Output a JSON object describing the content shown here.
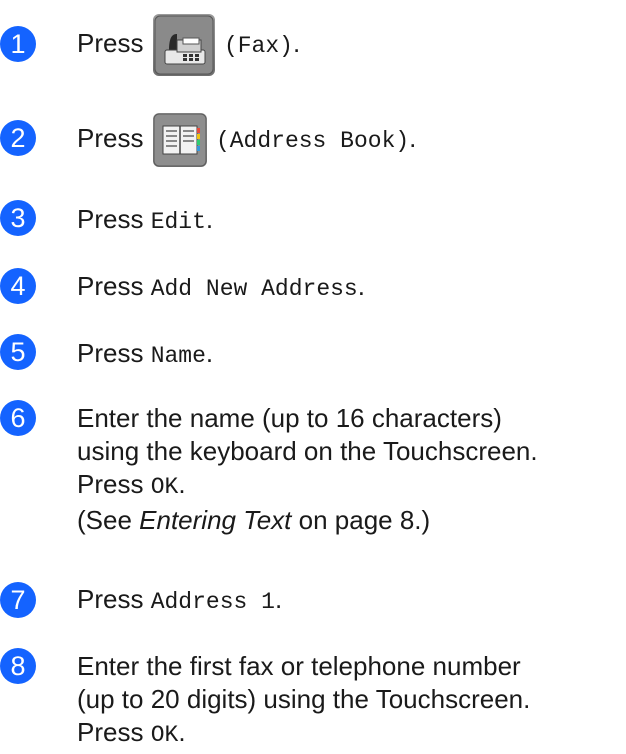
{
  "steps": [
    {
      "number": "1",
      "press": "Press",
      "button": "(Fax)",
      "end": ".",
      "icon": "fax-icon"
    },
    {
      "number": "2",
      "press": "Press",
      "button": "(Address Book)",
      "end": ".",
      "icon": "address-book-icon"
    },
    {
      "number": "3",
      "press": "Press",
      "button": "Edit",
      "end": "."
    },
    {
      "number": "4",
      "press": "Press",
      "button": "Add New Address",
      "end": "."
    },
    {
      "number": "5",
      "press": "Press",
      "button": "Name",
      "end": "."
    },
    {
      "number": "6",
      "line1": "Enter the name (up to 16 characters)",
      "line2": "using the keyboard on the Touchscreen.",
      "press": "Press",
      "button": "OK",
      "end": ".",
      "ref_open": "(See",
      "ref_title": "Entering Text",
      "ref_close": "on page 8.)"
    },
    {
      "number": "7",
      "press": "Press",
      "button": "Address 1",
      "end": "."
    },
    {
      "number": "8",
      "line1": "Enter the first fax or telephone number",
      "line2": "(up to 20 digits) using the Touchscreen.",
      "press": "Press",
      "button": "OK",
      "end": "."
    }
  ],
  "colors": {
    "step_circle": "#1463ff",
    "text": "#1a1a1a"
  }
}
